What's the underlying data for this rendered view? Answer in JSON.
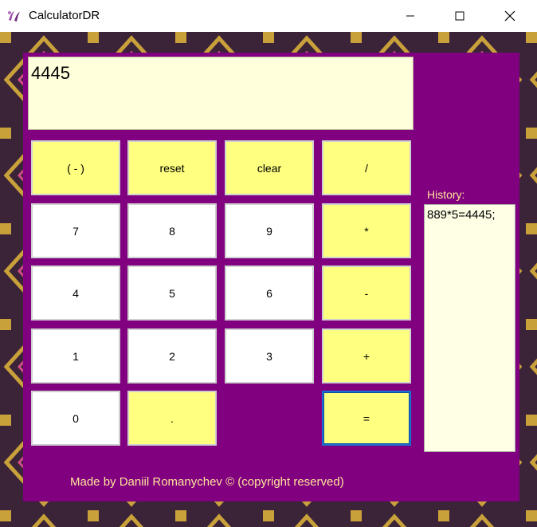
{
  "window": {
    "title": "CalculatorDR"
  },
  "display": {
    "value": "4445"
  },
  "keys": {
    "negate": "( - )",
    "reset": "reset",
    "clear": "clear",
    "divide": "/",
    "seven": "7",
    "eight": "8",
    "nine": "9",
    "multiply": "*",
    "four": "4",
    "five": "5",
    "six": "6",
    "minus": "-",
    "one": "1",
    "two": "2",
    "three": "3",
    "plus": "+",
    "zero": "0",
    "decimal": ".",
    "equals": "="
  },
  "history": {
    "label": "History:",
    "entries": "889*5=4445;"
  },
  "footer": {
    "credit": "Made by Daniil Romanychev © (copyright reserved)"
  },
  "colors": {
    "panel": "#800080",
    "key_white": "#ffffff",
    "key_yellow": "#ffff80",
    "display_bg": "#ffffdc",
    "label_text": "#ffe49a",
    "focus_border": "#1a6fd0"
  }
}
